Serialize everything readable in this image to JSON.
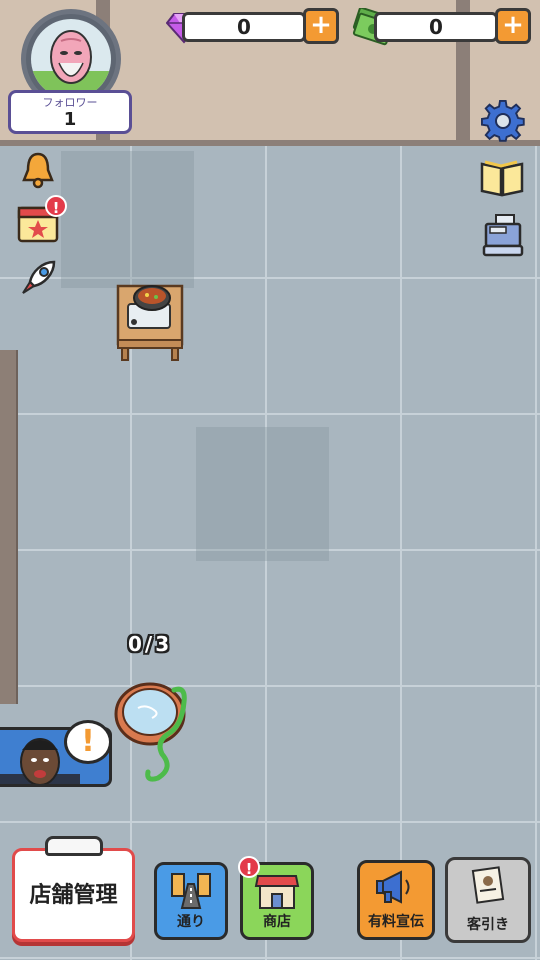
{
  "header": {
    "follower_label": "フォロワー",
    "follower_count": "1",
    "gems": "0",
    "cash": "0",
    "plus_label": "+"
  },
  "side_icons": [
    {
      "icon": "bell-icon"
    },
    {
      "icon": "calendar-icon",
      "badge": "!"
    },
    {
      "icon": "rocket-icon"
    }
  ],
  "right_icons": [
    {
      "icon": "gear-icon"
    },
    {
      "icon": "book-icon"
    },
    {
      "icon": "cash-register-icon"
    }
  ],
  "game": {
    "capacity": "0/3",
    "alert": "!"
  },
  "bottom_bar": {
    "manage_label": "店舗管理",
    "street_label": "通り",
    "shop_label": "商店",
    "shop_badge": "!",
    "ads_label": "有料宣伝",
    "customers_label": "客引き"
  },
  "colors": {
    "accent_orange": "#f39a33",
    "badge_red": "#e33b4a",
    "street_blue": "#4a9be6",
    "shop_green": "#8bd65a",
    "ads_orange": "#f39a33",
    "customers_gray": "#c9c9c9",
    "follower_purple": "#5a4f95"
  }
}
